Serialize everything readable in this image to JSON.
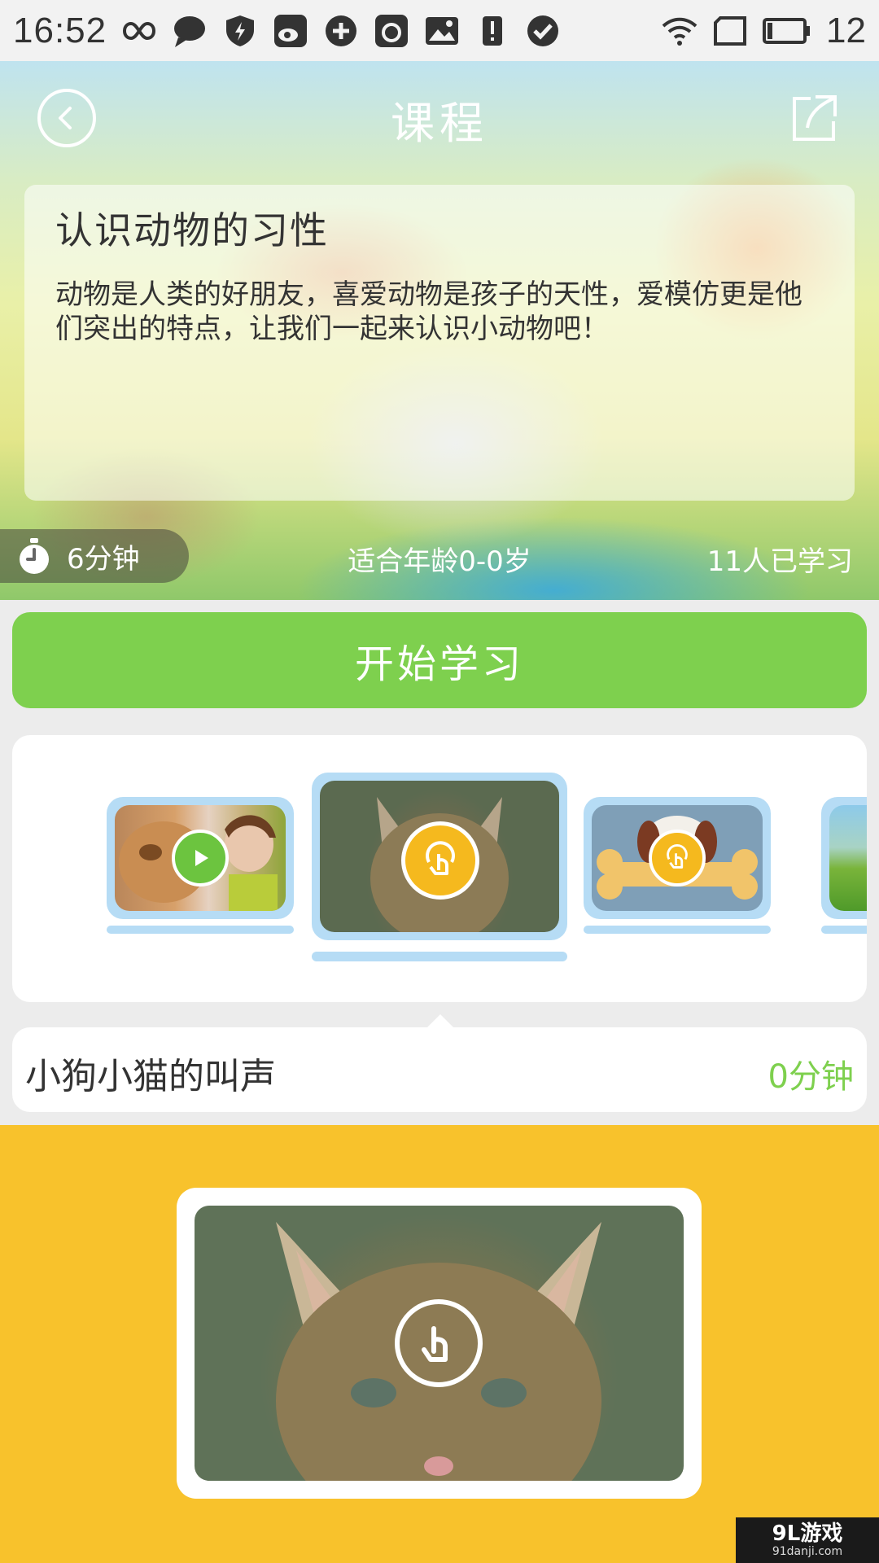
{
  "status_bar": {
    "time": "16:52",
    "battery_level": "12",
    "icons": [
      "infinity-icon",
      "message-icon",
      "shield-icon",
      "weibo-icon",
      "sync-icon",
      "app-icon",
      "image-icon",
      "alert-icon",
      "check-icon",
      "wifi-icon",
      "signal-icon",
      "battery-icon"
    ]
  },
  "header": {
    "title": "课程",
    "back_icon": "back-icon",
    "share_icon": "share-icon"
  },
  "course": {
    "title": "认识动物的习性",
    "description": "动物是人类的好朋友，喜爱动物是孩子的天性，爱模仿更是他们突出的特点，让我们一起来认识小动物吧！",
    "duration": "6分钟",
    "age_range": "适合年龄0-0岁",
    "learners": "11人已学习"
  },
  "start_button": {
    "label": "开始学习"
  },
  "carousel": {
    "items": [
      {
        "subject": "dog-and-child",
        "state_icon": "play-icon",
        "selected": false
      },
      {
        "subject": "kitten",
        "state_icon": "tap-icon",
        "selected": true
      },
      {
        "subject": "puppy-with-bone",
        "state_icon": "tap-icon",
        "selected": false
      },
      {
        "subject": "landscape",
        "state_icon": "",
        "selected": false
      }
    ]
  },
  "lesson": {
    "title": "小狗小猫的叫声",
    "duration": "0分钟"
  },
  "preview": {
    "subject": "kitten",
    "icon": "tap-icon"
  },
  "watermark": {
    "main": "9L游戏",
    "sub": "91danji.com"
  },
  "colors": {
    "accent_green": "#7ed04e",
    "bottom_yellow": "#f8c22c",
    "thumb_frame_blue": "#b6dcf5",
    "tap_yellow": "#f5b91e"
  }
}
